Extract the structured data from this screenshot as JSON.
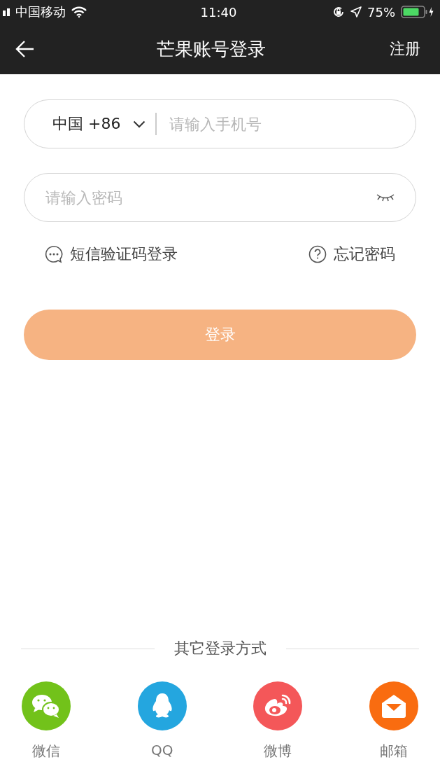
{
  "status_bar": {
    "carrier": "中国移动",
    "time": "11:40",
    "battery": "75%"
  },
  "nav_bar": {
    "title": "芒果账号登录",
    "action": "注册"
  },
  "phone_field": {
    "country": "中国 +86",
    "placeholder": "请输入手机号"
  },
  "password_field": {
    "placeholder": "请输入密码"
  },
  "links": [
    {
      "kind": "sms",
      "label": "短信验证码登录"
    },
    {
      "kind": "forgot",
      "label": "忘记密码"
    }
  ],
  "login_button": {
    "label": "登录",
    "disabled": true
  },
  "other_logins": {
    "heading": "其它登录方式",
    "items": [
      {
        "kind": "wechat",
        "label": "微信",
        "color": "#72c21a"
      },
      {
        "kind": "qq",
        "label": "QQ",
        "color": "#24a6df"
      },
      {
        "kind": "weibo",
        "label": "微博",
        "color": "#f45759"
      },
      {
        "kind": "email",
        "label": "邮箱",
        "color": "#f96c10"
      }
    ]
  }
}
